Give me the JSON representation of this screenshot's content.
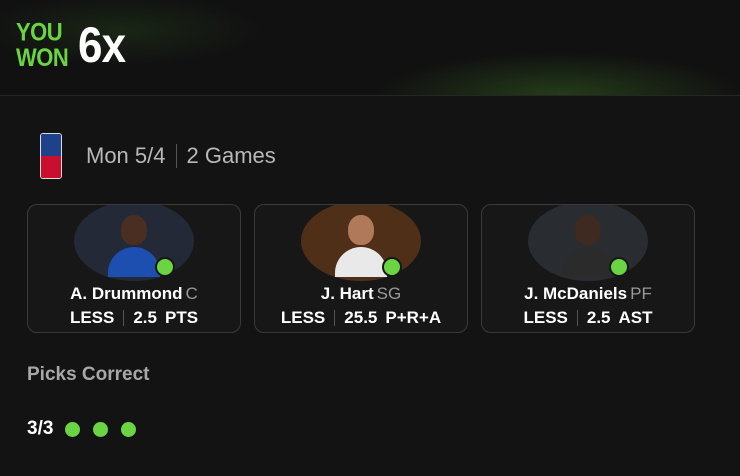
{
  "banner": {
    "you_label": "YOU",
    "won_label": "WON",
    "multiplier": "6x"
  },
  "slip": {
    "league_icon": "nba-logo-icon",
    "date": "Mon 5/4",
    "games": "2 Games"
  },
  "picks": [
    {
      "name": "A. Drummond",
      "position": "C",
      "direction": "LESS",
      "line": "2.5",
      "stat": "PTS",
      "result": "correct",
      "jersey_color": "#1d4fb0",
      "team_color": "#3d4a73"
    },
    {
      "name": "J. Hart",
      "position": "SG",
      "direction": "LESS",
      "line": "25.5",
      "stat": "P+R+A",
      "result": "correct",
      "jersey_color": "#e9e9e9",
      "team_color": "#b85c1a"
    },
    {
      "name": "J. McDaniels",
      "position": "PF",
      "direction": "LESS",
      "line": "2.5",
      "stat": "AST",
      "result": "correct",
      "jersey_color": "#2b2b2b",
      "team_color": "#4a5560"
    }
  ],
  "summary": {
    "label": "Picks Correct",
    "score": "3/3",
    "results": [
      "correct",
      "correct",
      "correct"
    ],
    "accent": "#6ad442"
  }
}
